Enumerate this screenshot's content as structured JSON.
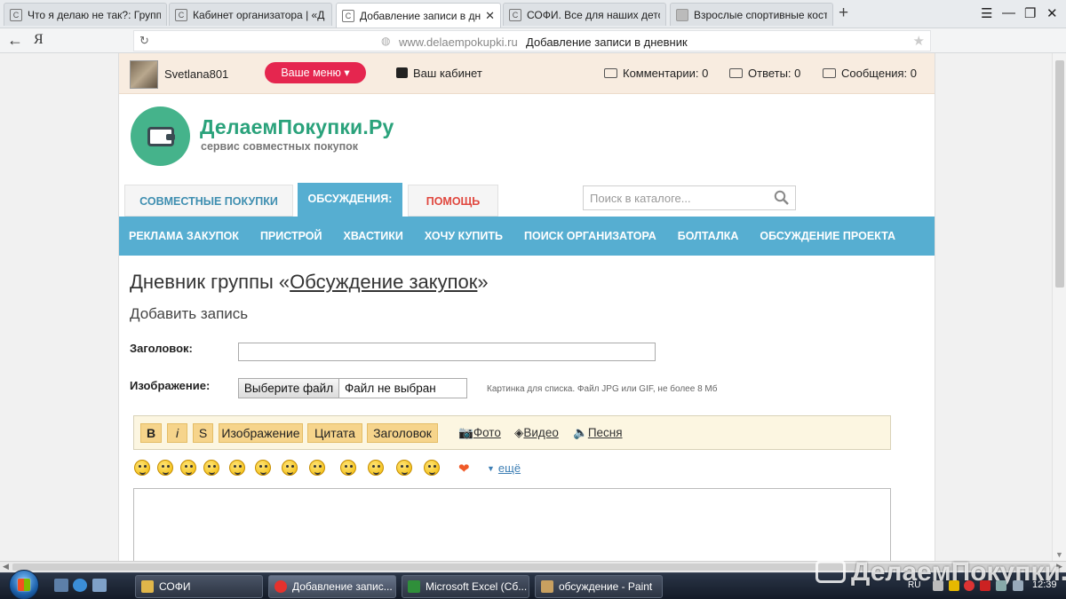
{
  "browser": {
    "tabs": [
      {
        "title": "Что я делаю не так?: Групп",
        "active": false
      },
      {
        "title": "Кабинет организатора | «Д",
        "active": false
      },
      {
        "title": "Добавление записи в дн",
        "active": true
      },
      {
        "title": "СОФИ. Все для наших дето",
        "active": false
      },
      {
        "title": "Взрослые спортивные кост",
        "active": false
      }
    ],
    "address": {
      "domain": "www.delaempokupki.ru",
      "page_title": "Добавление записи в дневник"
    },
    "yandex_label": "Я"
  },
  "userbar": {
    "username": "Svetlana801",
    "menu_button": "Ваше меню",
    "cabinet": "Ваш кабинет",
    "comments": "Комментарии: 0",
    "replies": "Ответы: 0",
    "messages": "Сообщения: 0"
  },
  "brand": {
    "name": "ДелаемПокупки.Ру",
    "slogan": "сервис совместных покупок"
  },
  "main_tabs": [
    {
      "label": "СОВМЕСТНЫЕ ПОКУПКИ",
      "active": false
    },
    {
      "label": "ОБСУЖДЕНИЯ:",
      "active": true
    },
    {
      "label": "ПОМОЩЬ",
      "active": false
    }
  ],
  "search": {
    "placeholder": "Поиск в каталоге..."
  },
  "subnav": [
    "РЕКЛАМА ЗАКУПОК",
    "ПРИСТРОЙ",
    "ХВАСТИКИ",
    "ХОЧУ КУПИТЬ",
    "ПОИСК ОРГАНИЗАТОРА",
    "БОЛТАЛКА",
    "ОБСУЖДЕНИЕ ПРОЕКТА"
  ],
  "heading": {
    "prefix": "Дневник группы «",
    "group_link": "Обсуждение закупок",
    "suffix": "»"
  },
  "subheading": "Добавить запись",
  "form": {
    "title_label": "Заголовок:",
    "title_value": "",
    "image_label": "Изображение:",
    "file_button": "Выберите файл",
    "file_status": "Файл не выбран",
    "file_hint": "Картинка для списка. Файл JPG или GIF, не более 8 Мб"
  },
  "editor_toolbar": {
    "bold": "B",
    "italic": "i",
    "strike": "S",
    "image": "Изображение",
    "quote": "Цитата",
    "header": "Заголовок",
    "photo": "Фото",
    "video": "Видео",
    "song": "Песня"
  },
  "smileys_more": "ещё",
  "taskbar": {
    "tasks": [
      {
        "label": "СОФИ",
        "active": false
      },
      {
        "label": "Добавление запис...",
        "active": true
      },
      {
        "label": "Microsoft Excel (Сб...",
        "active": false
      },
      {
        "label": "обсуждение - Paint",
        "active": false
      }
    ],
    "watermark": "ДелаемПокупки.Ру",
    "language": "RU",
    "clock": "12:39"
  },
  "colors": {
    "accent_green": "#2aa27b",
    "nav_blue": "#56aed1",
    "menu_red": "#e5264f",
    "help_red": "#e0473e",
    "toolbar_yellow": "#f6d48b"
  }
}
